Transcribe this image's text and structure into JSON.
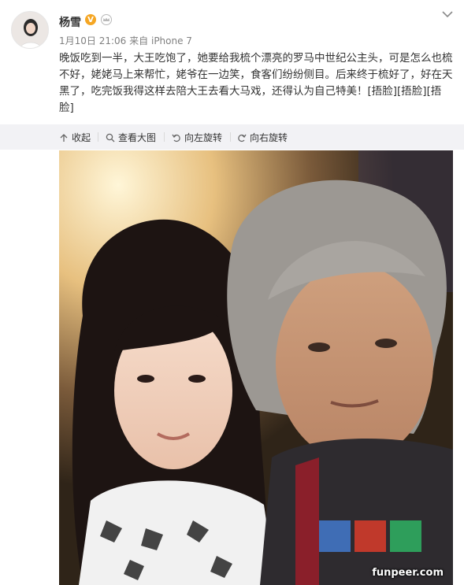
{
  "user": {
    "name": "杨雪",
    "verified_badge": "V"
  },
  "post": {
    "date": "1月10日 21:06",
    "source_prefix": "来自",
    "source": "iPhone 7",
    "text_main": "晚饭吃到一半，大王吃饱了，她要给我梳个漂亮的罗马中世纪公主头，可是怎么也梳不好，姥姥马上来帮忙，姥爷在一边笑，食客们纷纷侧目。后来终于梳好了，好在天黑了，吃完饭我得这样去陪大王去看大马戏，还得认为自己特美！",
    "emoji_text": "[捂脸][捂脸][捂脸]"
  },
  "toolbar": {
    "collapse": "收起",
    "view_large": "查看大图",
    "rotate_left": "向左旋转",
    "rotate_right": "向右旋转"
  },
  "watermark": "funpeer.com",
  "icons": [
    "chevron-down-icon",
    "crown-icon",
    "collapse-icon",
    "search-icon",
    "rotate-left-icon",
    "rotate-right-icon"
  ]
}
